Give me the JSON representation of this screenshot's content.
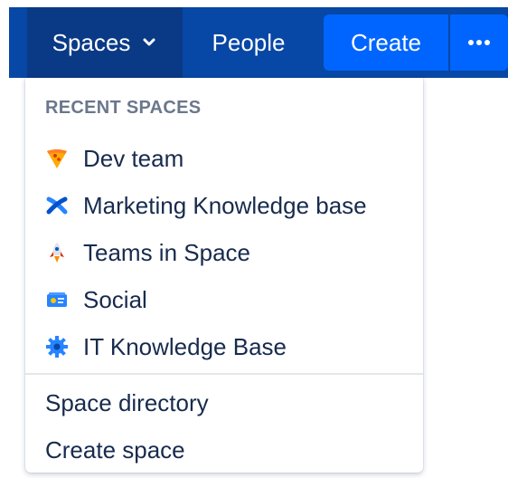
{
  "nav": {
    "spaces_label": "Spaces",
    "people_label": "People",
    "create_label": "Create"
  },
  "dropdown": {
    "recent_heading": "RECENT SPACES",
    "recent_spaces": [
      {
        "label": "Dev team",
        "icon": "pizza-icon"
      },
      {
        "label": "Marketing Knowledge base",
        "icon": "blue-x-icon"
      },
      {
        "label": "Teams in Space",
        "icon": "rocket-icon"
      },
      {
        "label": "Social",
        "icon": "id-card-icon"
      },
      {
        "label": "IT Knowledge Base",
        "icon": "gear-icon"
      }
    ],
    "links": [
      {
        "label": "Space directory"
      },
      {
        "label": "Create space"
      }
    ]
  },
  "colors": {
    "header_bg": "#0747a6",
    "spaces_active_bg": "#0a3a86",
    "create_bg": "#0065ff",
    "heading_text": "#6b778c",
    "item_text": "#172b4d"
  }
}
